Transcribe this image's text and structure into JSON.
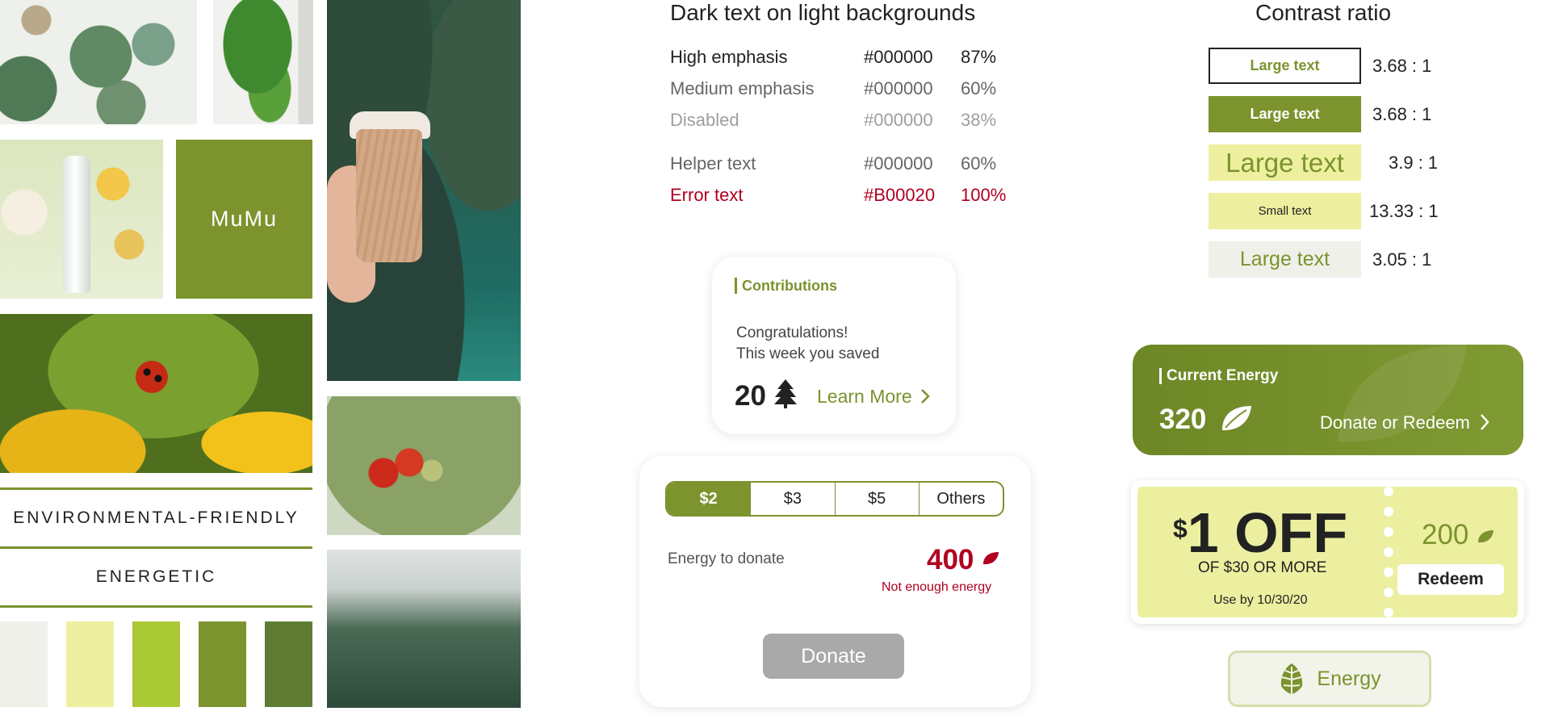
{
  "brand": {
    "name": "MuMu",
    "keywords": [
      "ENVIRONMENTAL-FRIENDLY",
      "ENERGETIC"
    ],
    "palette": [
      "#eff0ea",
      "#eeef9f",
      "#abc835",
      "#7c932e",
      "#5f7b34"
    ],
    "accent": "#7c932e"
  },
  "dark_text": {
    "title": "Dark text on light backgrounds",
    "rows": [
      {
        "name": "High emphasis",
        "hex": "#000000",
        "pct": "87%",
        "color": "#222222"
      },
      {
        "name": "Medium emphasis",
        "hex": "#000000",
        "pct": "60%",
        "color": "#666666"
      },
      {
        "name": "Disabled",
        "hex": "#000000",
        "pct": "38%",
        "color": "#9e9e9e"
      },
      {
        "name": "Helper text",
        "hex": "#000000",
        "pct": "60%",
        "color": "#666666"
      },
      {
        "name": "Error text",
        "hex": "#B00020",
        "pct": "100%",
        "color": "#b00020"
      }
    ]
  },
  "contrast": {
    "title": "Contrast ratio",
    "rows": [
      {
        "label": "Large text",
        "ratio": "3.68 : 1"
      },
      {
        "label": "Large text",
        "ratio": "3.68 : 1"
      },
      {
        "label": "Large text",
        "ratio": "3.9 : 1"
      },
      {
        "label": "Small text",
        "ratio": "13.33 : 1"
      },
      {
        "label": "Large text",
        "ratio": "3.05 : 1"
      }
    ]
  },
  "contributions": {
    "title": "Contributions",
    "line1": "Congratulations!",
    "line2": "This week you saved",
    "count": "20",
    "link": "Learn More"
  },
  "donate": {
    "options": [
      "$2",
      "$3",
      "$5",
      "Others"
    ],
    "selected": "$2",
    "label": "Energy to donate",
    "amount": "400",
    "error": "Not enough energy",
    "button": "Donate"
  },
  "energy": {
    "title": "Current Energy",
    "value": "320",
    "action": "Donate or Redeem"
  },
  "coupon": {
    "currency": "$",
    "headline": "1 OFF",
    "subline": "OF $30 OR MORE",
    "expiry": "Use by 10/30/20",
    "cost": "200",
    "button": "Redeem"
  },
  "energy_tab": {
    "label": "Energy"
  }
}
